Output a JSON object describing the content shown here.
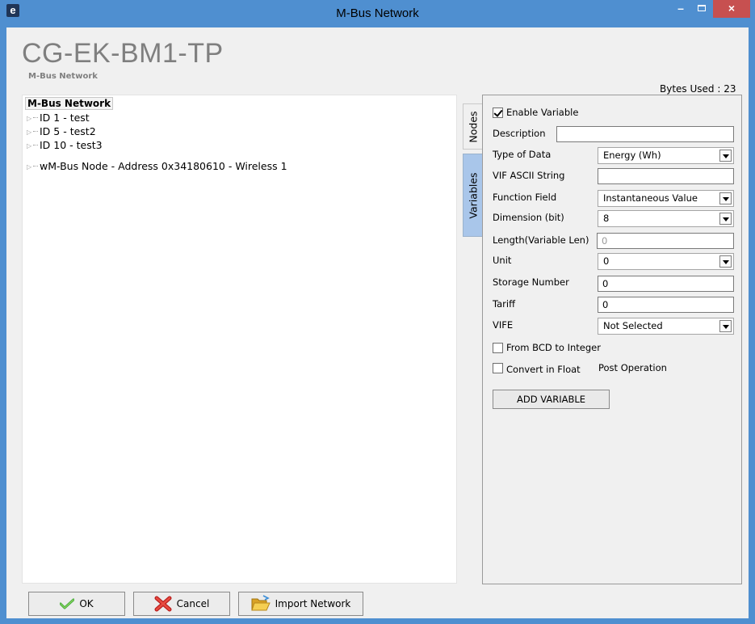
{
  "window": {
    "title": "M-Bus Network",
    "app_icon_letter": "e",
    "close_glyph": "×",
    "minimize_glyph": "–",
    "accent_color": "#4f8fd0",
    "close_color": "#c75050"
  },
  "header": {
    "product_name": "CG-EK-BM1-TP",
    "subtitle": "M-Bus Network",
    "bytes_used": "Bytes Used : 23"
  },
  "tree": {
    "root_label": "M-Bus Network",
    "items": [
      {
        "label": "ID 1 - test"
      },
      {
        "label": "ID 5 - test2"
      },
      {
        "label": "ID 10 - test3"
      },
      {
        "label": "wM-Bus Node - Address 0x34180610 - Wireless 1"
      }
    ]
  },
  "tabs": {
    "nodes": "Nodes",
    "variables": "Variables",
    "active": "Variables"
  },
  "form": {
    "enable_variable": {
      "label": "Enable Variable",
      "checked": true
    },
    "description": {
      "label": "Description",
      "value": ""
    },
    "type_of_data": {
      "label": "Type of Data",
      "value": "Energy (Wh)"
    },
    "vif_ascii": {
      "label": "VIF ASCII String",
      "value": ""
    },
    "function_field": {
      "label": "Function Field",
      "value": "Instantaneous Value"
    },
    "dimension": {
      "label": "Dimension (bit)",
      "value": "8"
    },
    "length": {
      "label": "Length(Variable Len)",
      "value": "0"
    },
    "unit": {
      "label": "Unit",
      "value": "0"
    },
    "storage_number": {
      "label": "Storage Number",
      "value": "0"
    },
    "tariff": {
      "label": "Tariff",
      "value": "0"
    },
    "vife": {
      "label": "VIFE",
      "value": "Not Selected"
    },
    "from_bcd": {
      "label": "From BCD to Integer",
      "checked": false
    },
    "convert_float": {
      "label": "Convert in Float",
      "checked": false
    },
    "post_operation": "Post Operation",
    "add_button": "ADD VARIABLE"
  },
  "footer": {
    "ok": "OK",
    "cancel": "Cancel",
    "import": "Import Network"
  },
  "icons": {
    "ok": "check-icon",
    "cancel": "red-x-icon",
    "import": "folder-open-icon"
  }
}
